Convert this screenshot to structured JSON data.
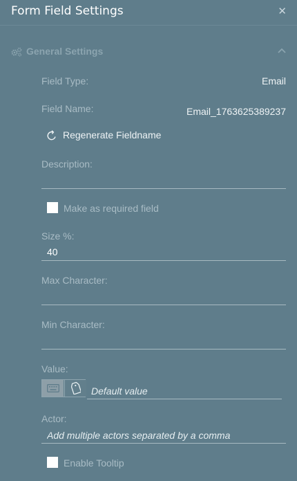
{
  "panel": {
    "title": "Form Field Settings",
    "close_icon": "close-icon"
  },
  "section": {
    "label": "General Settings",
    "icon": "gears-icon",
    "toggle_icon": "chevron-up-icon"
  },
  "field_type": {
    "label": "Field Type:",
    "value": "Email"
  },
  "field_name": {
    "label": "Field Name:",
    "value": "Email_1763625389237"
  },
  "regenerate": {
    "label": "Regenerate Fieldname",
    "icon": "refresh-icon"
  },
  "description": {
    "label": "Description:",
    "value": ""
  },
  "required": {
    "label": "Make as required field",
    "checked": false
  },
  "size": {
    "label": "Size %:",
    "value": "40"
  },
  "max_character": {
    "label": "Max Character:",
    "value": ""
  },
  "min_character": {
    "label": "Min Character:",
    "value": ""
  },
  "value_field": {
    "label": "Value:",
    "placeholder": "Default value",
    "mode_icons": [
      "keyboard-icon",
      "tag-icon"
    ],
    "active_mode": "keyboard"
  },
  "actor": {
    "label": "Actor:",
    "placeholder": "Add multiple actors separated by a comma"
  },
  "tooltip": {
    "label": "Enable Tooltip",
    "checked": false
  },
  "colors": {
    "background": "#5f7d8b",
    "label": "#a9bcc5",
    "text": "#ffffff",
    "active_toggle": "#8e9fa8"
  }
}
